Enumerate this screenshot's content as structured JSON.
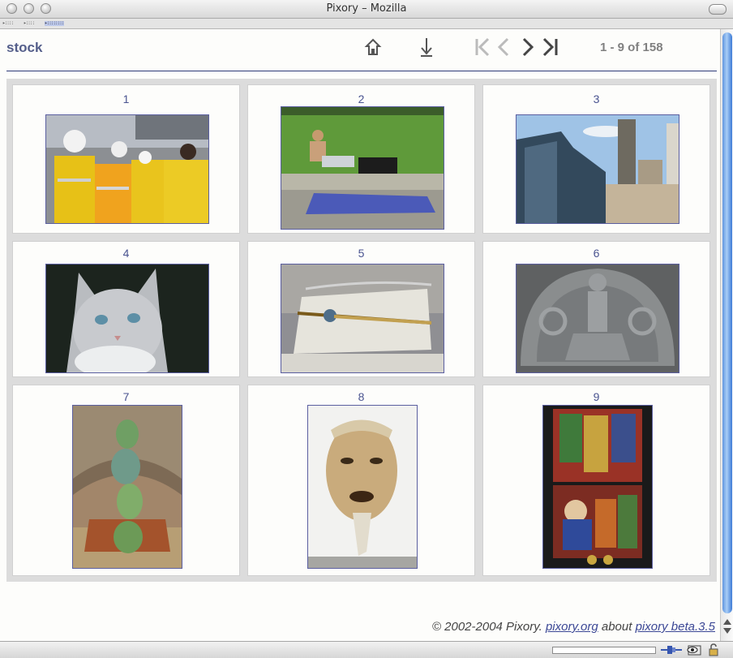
{
  "window": {
    "title": "Pixory – Mozilla"
  },
  "tabs": [
    {
      "label": "▸::::"
    },
    {
      "label": "▸::::"
    },
    {
      "label": "▸::::::::"
    }
  ],
  "header": {
    "logo": "stock",
    "counter": "1 - 9 of 158"
  },
  "nav_icons": [
    "home-icon",
    "download-icon",
    "first-page-icon",
    "previous-page-icon",
    "next-page-icon",
    "last-page-icon"
  ],
  "gallery": {
    "items": [
      {
        "number": "1",
        "subject": "construction-workers-photo"
      },
      {
        "number": "2",
        "subject": "man-on-grass-photo"
      },
      {
        "number": "3",
        "subject": "city-buildings-photo"
      },
      {
        "number": "4",
        "subject": "cat-photo"
      },
      {
        "number": "5",
        "subject": "katana-sword-photo"
      },
      {
        "number": "6",
        "subject": "stone-relief-photo"
      },
      {
        "number": "7",
        "subject": "glass-chandelier-photo"
      },
      {
        "number": "8",
        "subject": "noh-mask-photo"
      },
      {
        "number": "9",
        "subject": "stained-glass-photo"
      }
    ]
  },
  "footer": {
    "copyright": "© 2002-2004 Pixory.",
    "site_link": "pixory.org",
    "about_text": "about",
    "version_link": "pixory beta.3.5"
  },
  "colors": {
    "accent": "#545e8a",
    "link": "#3c4896",
    "rule": "#2e3a78",
    "scroll": "#5f95df"
  }
}
